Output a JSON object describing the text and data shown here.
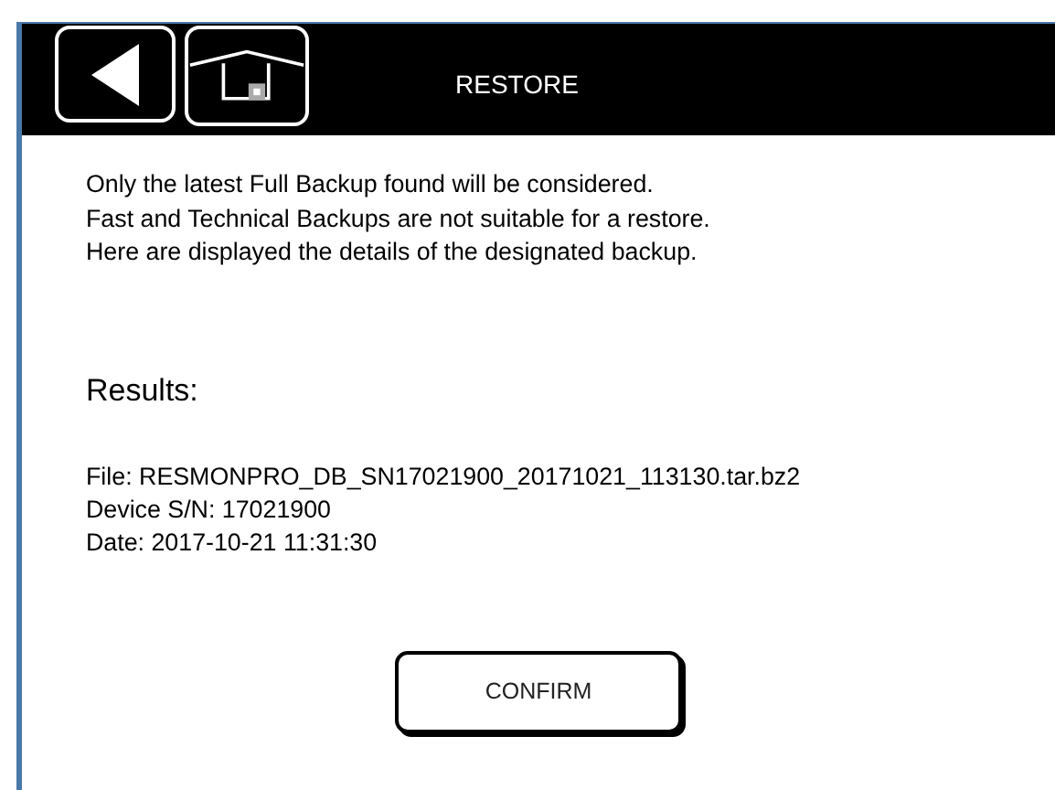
{
  "header": {
    "title": "RESTORE"
  },
  "intro": [
    "Only the latest Full Backup found will be considered.",
    "Fast and Technical Backups are not suitable for a restore.",
    "Here are displayed the details of the designated backup."
  ],
  "results": {
    "heading": "Results:",
    "lines": [
      "File: RESMONPRO_DB_SN17021900_20171021_113130.tar.bz2",
      "Device S/N: 17021900",
      "Date: 2017-10-21 11:31:30"
    ]
  },
  "buttons": [
    "CONFIRM"
  ]
}
